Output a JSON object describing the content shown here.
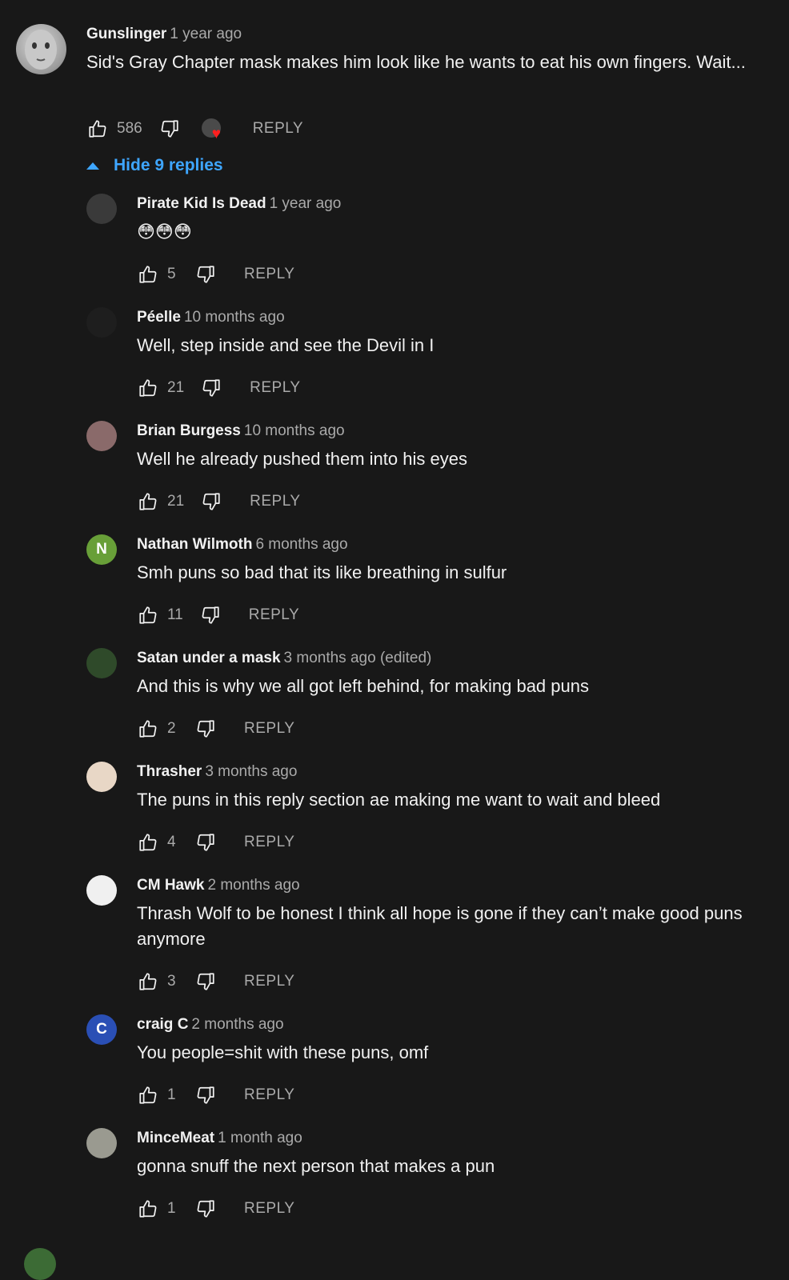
{
  "top_comment": {
    "author": "Gunslinger",
    "time": "1 year ago",
    "text": "Sid's Gray Chapter mask makes him look like he wants to eat his own fingers. Wait...",
    "likes": "586",
    "reply_label": "REPLY",
    "avatar_icon": "gray-mask-avatar",
    "creator_heart_icon": "heart-icon"
  },
  "replies_toggle": {
    "label": "Hide 9 replies"
  },
  "replies": [
    {
      "author": "Pirate Kid Is Dead",
      "time": "1 year ago",
      "text": "😳😳😳",
      "likes": "5",
      "reply_label": "REPLY",
      "avatar_color": "#3a3a3a",
      "avatar_letter": ""
    },
    {
      "author": "Péelle",
      "time": "10 months ago",
      "text": "Well, step inside and see the Devil in I",
      "likes": "21",
      "reply_label": "REPLY",
      "avatar_color": "#1e1e1e",
      "avatar_letter": ""
    },
    {
      "author": "Brian Burgess",
      "time": "10 months ago",
      "text": "Well he already pushed them into his eyes",
      "likes": "21",
      "reply_label": "REPLY",
      "avatar_color": "#8a6a6a",
      "avatar_letter": ""
    },
    {
      "author": "Nathan Wilmoth",
      "time": "6 months ago",
      "text": "Smh puns so bad that its like breathing in sulfur",
      "likes": "11",
      "reply_label": "REPLY",
      "avatar_color": "#689f38",
      "avatar_letter": "N"
    },
    {
      "author": "Satan under a mask",
      "time": "3 months ago (edited)",
      "text": "And this is why we all got left behind, for making bad puns",
      "likes": "2",
      "reply_label": "REPLY",
      "avatar_color": "#2f4a2a",
      "avatar_letter": ""
    },
    {
      "author": "Thrasher",
      "time": "3 months ago",
      "text": "The puns in this reply section ae making me want to wait and bleed",
      "likes": "4",
      "reply_label": "REPLY",
      "avatar_color": "#e8d7c6",
      "avatar_letter": ""
    },
    {
      "author": "CM Hawk",
      "time": "2 months ago",
      "text": "Thrash Wolf to be honest I think all hope is gone if they can’t make good puns anymore",
      "likes": "3",
      "reply_label": "REPLY",
      "avatar_color": "#f0f0f0",
      "avatar_letter": ""
    },
    {
      "author": "craig C",
      "time": "2 months ago",
      "text": "You people=shit with these puns, omf",
      "likes": "1",
      "reply_label": "REPLY",
      "avatar_color": "#2a4fb5",
      "avatar_letter": "C"
    },
    {
      "author": "MinceMeat",
      "time": "1 month ago",
      "text": "gonna snuff the next person that makes a pun",
      "likes": "1",
      "reply_label": "REPLY",
      "avatar_color": "#9a9a90",
      "avatar_letter": ""
    }
  ],
  "colors": {
    "background": "#181818",
    "link": "#3ea6ff",
    "secondary_text": "#aaaaaa"
  }
}
